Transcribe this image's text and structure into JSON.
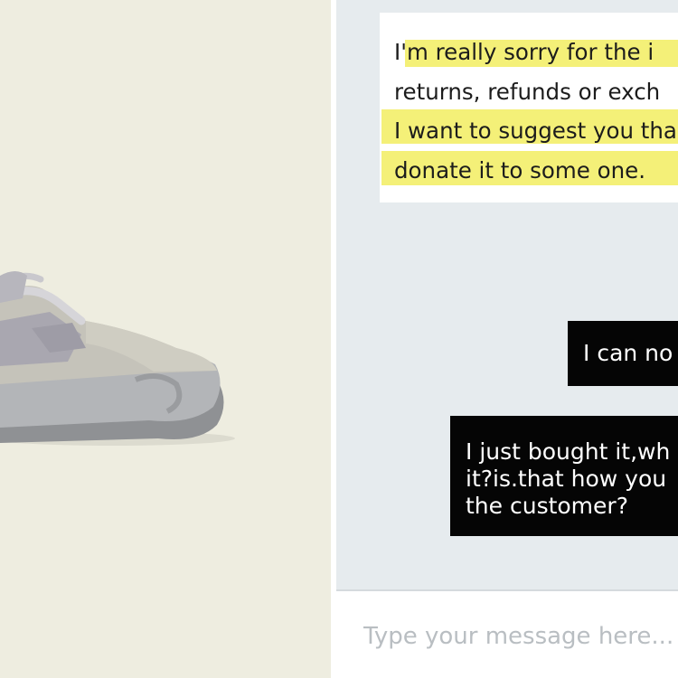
{
  "chat": {
    "support_message": {
      "lines": [
        "I'm really sorry for the i",
        "returns, refunds or exch",
        "I want to suggest you tha",
        "donate it to some one."
      ]
    },
    "user_messages": [
      {
        "lines": [
          "I can no"
        ]
      },
      {
        "lines": [
          "I just bought it,wh",
          "it?is.that how you",
          "the customer?"
        ]
      }
    ],
    "composer": {
      "placeholder": "Type your message here..."
    }
  },
  "colors": {
    "left_background": "#eeede0",
    "chat_background": "#e6ebee",
    "highlight": "#f4f078",
    "user_bubble": "#050505",
    "support_bubble": "#ffffff"
  }
}
